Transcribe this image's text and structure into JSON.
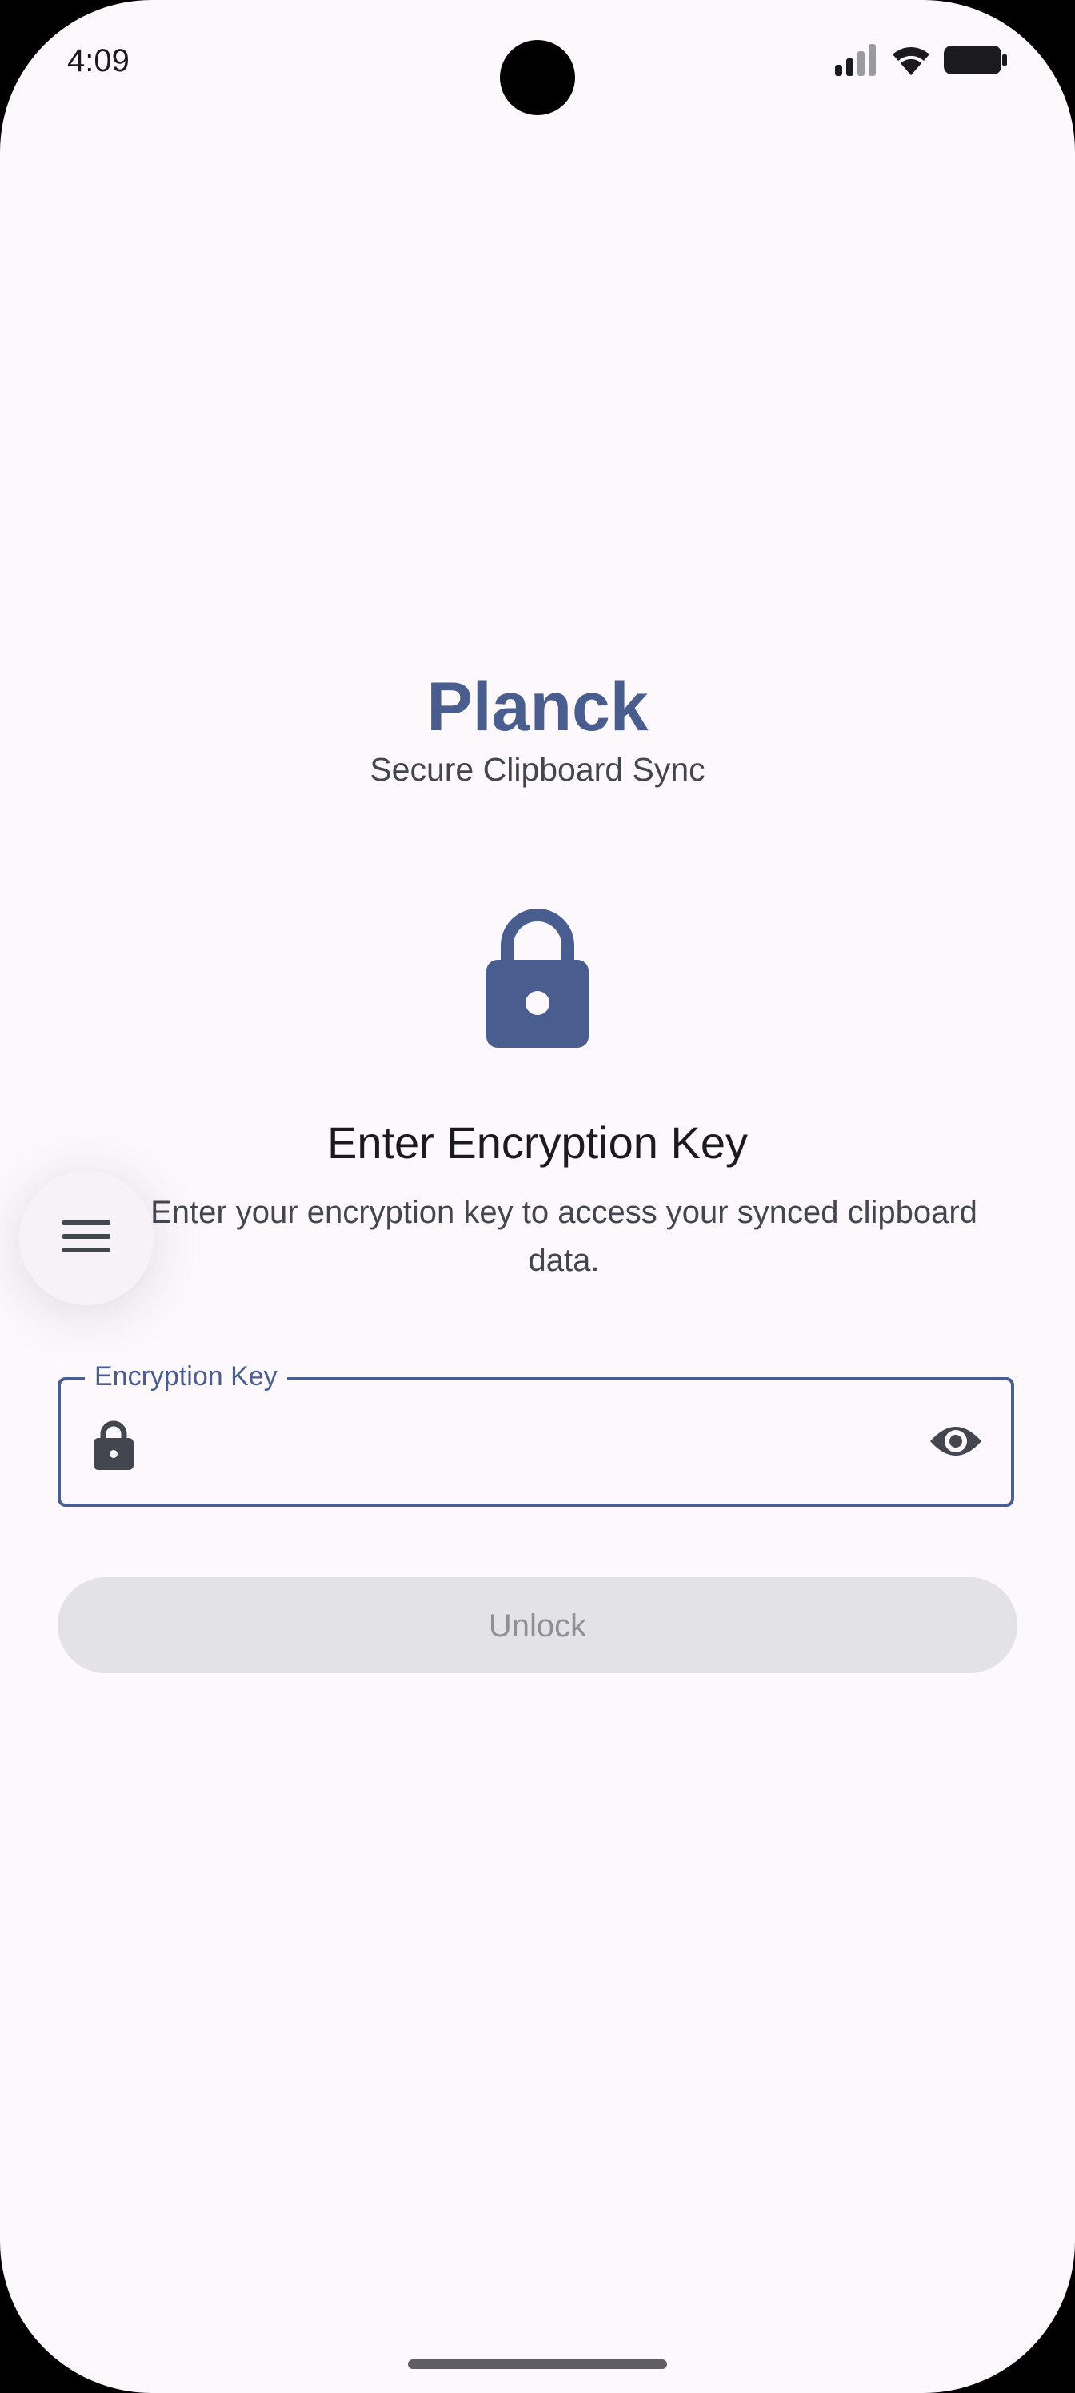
{
  "status_bar": {
    "time": "4:09",
    "icons": [
      "signal-icon",
      "wifi-icon",
      "battery-icon"
    ]
  },
  "header": {
    "title": "Planck",
    "subtitle": "Secure Clipboard Sync"
  },
  "main": {
    "heading": "Enter Encryption Key",
    "description": "Enter your encryption key to access your synced clipboard data.",
    "key_field": {
      "label": "Encryption Key",
      "value": "",
      "leading_icon": "lock-icon",
      "trailing_icon": "visibility-icon"
    },
    "unlock_label": "Unlock"
  },
  "menu_button": {
    "icon": "menu-icon"
  },
  "colors": {
    "primary": "#4a5d8f",
    "background": "#fcf8fc",
    "disabled_button": "#e3e2e6",
    "disabled_text": "#8f9097"
  }
}
